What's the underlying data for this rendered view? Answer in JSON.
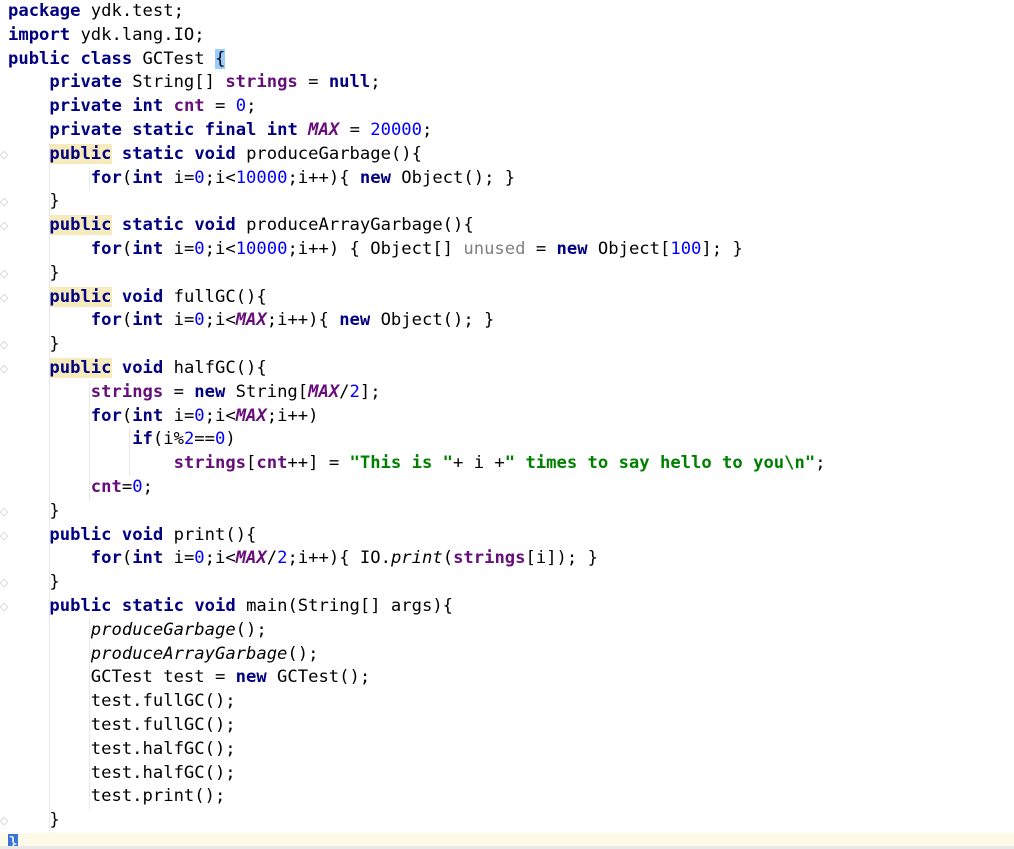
{
  "file": {
    "lines": [
      [
        {
          "t": "package",
          "c": "kw"
        },
        {
          "t": " ydk.test;"
        }
      ],
      [
        {
          "t": "import",
          "c": "kw"
        },
        {
          "t": " ydk.lang.IO;"
        }
      ],
      [
        {
          "t": "public",
          "c": "kw"
        },
        {
          "t": " "
        },
        {
          "t": "class",
          "c": "kw"
        },
        {
          "t": " GCTest "
        },
        {
          "t": "{",
          "c": "brace-hl"
        }
      ],
      [
        {
          "t": "    "
        },
        {
          "t": "private",
          "c": "kw"
        },
        {
          "t": " String[] "
        },
        {
          "t": "strings",
          "c": "fld"
        },
        {
          "t": " = "
        },
        {
          "t": "null",
          "c": "kw"
        },
        {
          "t": ";"
        }
      ],
      [
        {
          "t": "    "
        },
        {
          "t": "private",
          "c": "kw"
        },
        {
          "t": " "
        },
        {
          "t": "int",
          "c": "kw"
        },
        {
          "t": " "
        },
        {
          "t": "cnt",
          "c": "fld"
        },
        {
          "t": " = "
        },
        {
          "t": "0",
          "c": "num"
        },
        {
          "t": ";"
        }
      ],
      [
        {
          "t": "    "
        },
        {
          "t": "private",
          "c": "kw"
        },
        {
          "t": " "
        },
        {
          "t": "static",
          "c": "kw"
        },
        {
          "t": " "
        },
        {
          "t": "final",
          "c": "kw"
        },
        {
          "t": " "
        },
        {
          "t": "int",
          "c": "kw"
        },
        {
          "t": " "
        },
        {
          "t": "MAX",
          "c": "cst"
        },
        {
          "t": " = "
        },
        {
          "t": "20000",
          "c": "num"
        },
        {
          "t": ";"
        }
      ],
      [
        {
          "t": "    "
        },
        {
          "t": "public",
          "c": "kw hl-kw"
        },
        {
          "t": " "
        },
        {
          "t": "static",
          "c": "kw"
        },
        {
          "t": " "
        },
        {
          "t": "void",
          "c": "kw"
        },
        {
          "t": " produceGarbage(){"
        }
      ],
      [
        {
          "t": "        "
        },
        {
          "t": "for",
          "c": "kw"
        },
        {
          "t": "("
        },
        {
          "t": "int",
          "c": "kw"
        },
        {
          "t": " i="
        },
        {
          "t": "0",
          "c": "num"
        },
        {
          "t": ";i<"
        },
        {
          "t": "10000",
          "c": "num"
        },
        {
          "t": ";i++){ "
        },
        {
          "t": "new",
          "c": "kw"
        },
        {
          "t": " Object(); }"
        }
      ],
      [
        {
          "t": "    }"
        }
      ],
      [
        {
          "t": "    "
        },
        {
          "t": "public",
          "c": "kw hl-kw"
        },
        {
          "t": " "
        },
        {
          "t": "static",
          "c": "kw"
        },
        {
          "t": " "
        },
        {
          "t": "void",
          "c": "kw"
        },
        {
          "t": " produceArrayGarbage(){"
        }
      ],
      [
        {
          "t": "        "
        },
        {
          "t": "for",
          "c": "kw"
        },
        {
          "t": "("
        },
        {
          "t": "int",
          "c": "kw"
        },
        {
          "t": " i="
        },
        {
          "t": "0",
          "c": "num"
        },
        {
          "t": ";i<"
        },
        {
          "t": "10000",
          "c": "num"
        },
        {
          "t": ";i++) { Object[] "
        },
        {
          "t": "unused",
          "c": "unused"
        },
        {
          "t": " = "
        },
        {
          "t": "new",
          "c": "kw"
        },
        {
          "t": " Object["
        },
        {
          "t": "100",
          "c": "num"
        },
        {
          "t": "]; }"
        }
      ],
      [
        {
          "t": "    }"
        }
      ],
      [
        {
          "t": "    "
        },
        {
          "t": "public",
          "c": "kw hl-kw"
        },
        {
          "t": " "
        },
        {
          "t": "void",
          "c": "kw"
        },
        {
          "t": " fullGC(){"
        }
      ],
      [
        {
          "t": "        "
        },
        {
          "t": "for",
          "c": "kw"
        },
        {
          "t": "("
        },
        {
          "t": "int",
          "c": "kw"
        },
        {
          "t": " i="
        },
        {
          "t": "0",
          "c": "num"
        },
        {
          "t": ";i<"
        },
        {
          "t": "MAX",
          "c": "cst"
        },
        {
          "t": ";i++){ "
        },
        {
          "t": "new",
          "c": "kw"
        },
        {
          "t": " Object(); }"
        }
      ],
      [
        {
          "t": "    }"
        }
      ],
      [
        {
          "t": "    "
        },
        {
          "t": "public",
          "c": "kw hl-kw"
        },
        {
          "t": " "
        },
        {
          "t": "void",
          "c": "kw"
        },
        {
          "t": " halfGC(){"
        }
      ],
      [
        {
          "t": "        "
        },
        {
          "t": "strings",
          "c": "fld"
        },
        {
          "t": " = "
        },
        {
          "t": "new",
          "c": "kw"
        },
        {
          "t": " String["
        },
        {
          "t": "MAX",
          "c": "cst"
        },
        {
          "t": "/"
        },
        {
          "t": "2",
          "c": "num"
        },
        {
          "t": "];"
        }
      ],
      [
        {
          "t": "        "
        },
        {
          "t": "for",
          "c": "kw"
        },
        {
          "t": "("
        },
        {
          "t": "int",
          "c": "kw"
        },
        {
          "t": " i="
        },
        {
          "t": "0",
          "c": "num"
        },
        {
          "t": ";i<"
        },
        {
          "t": "MAX",
          "c": "cst"
        },
        {
          "t": ";i++)"
        }
      ],
      [
        {
          "t": "            "
        },
        {
          "t": "if",
          "c": "kw"
        },
        {
          "t": "(i%"
        },
        {
          "t": "2",
          "c": "num"
        },
        {
          "t": "=="
        },
        {
          "t": "0",
          "c": "num"
        },
        {
          "t": ")"
        }
      ],
      [
        {
          "t": "                "
        },
        {
          "t": "strings",
          "c": "fld"
        },
        {
          "t": "["
        },
        {
          "t": "cnt",
          "c": "fld"
        },
        {
          "t": "++] = "
        },
        {
          "t": "\"This is \"",
          "c": "str"
        },
        {
          "t": "+ i +"
        },
        {
          "t": "\" times to say hello to you\\n\"",
          "c": "str"
        },
        {
          "t": ";"
        }
      ],
      [
        {
          "t": "        "
        },
        {
          "t": "cnt",
          "c": "fld"
        },
        {
          "t": "="
        },
        {
          "t": "0",
          "c": "num"
        },
        {
          "t": ";"
        }
      ],
      [
        {
          "t": "    }"
        }
      ],
      [
        {
          "t": "    "
        },
        {
          "t": "public",
          "c": "kw"
        },
        {
          "t": " "
        },
        {
          "t": "void",
          "c": "kw"
        },
        {
          "t": " print(){"
        }
      ],
      [
        {
          "t": "        "
        },
        {
          "t": "for",
          "c": "kw"
        },
        {
          "t": "("
        },
        {
          "t": "int",
          "c": "kw"
        },
        {
          "t": " i="
        },
        {
          "t": "0",
          "c": "num"
        },
        {
          "t": ";i<"
        },
        {
          "t": "MAX",
          "c": "cst"
        },
        {
          "t": "/"
        },
        {
          "t": "2",
          "c": "num"
        },
        {
          "t": ";i++){ IO."
        },
        {
          "t": "print",
          "c": "mtd"
        },
        {
          "t": "("
        },
        {
          "t": "strings",
          "c": "fld"
        },
        {
          "t": "[i]); }"
        }
      ],
      [
        {
          "t": "    }"
        }
      ],
      [
        {
          "t": "    "
        },
        {
          "t": "public",
          "c": "kw"
        },
        {
          "t": " "
        },
        {
          "t": "static",
          "c": "kw"
        },
        {
          "t": " "
        },
        {
          "t": "void",
          "c": "kw"
        },
        {
          "t": " main(String[] args){"
        }
      ],
      [
        {
          "t": "        "
        },
        {
          "t": "produceGarbage",
          "c": "mtd"
        },
        {
          "t": "();"
        }
      ],
      [
        {
          "t": "        "
        },
        {
          "t": "produceArrayGarbage",
          "c": "mtd"
        },
        {
          "t": "();"
        }
      ],
      [
        {
          "t": "        GCTest test = "
        },
        {
          "t": "new",
          "c": "kw"
        },
        {
          "t": " GCTest();"
        }
      ],
      [
        {
          "t": "        test.fullGC();"
        }
      ],
      [
        {
          "t": "        test.fullGC();"
        }
      ],
      [
        {
          "t": "        test.halfGC();"
        }
      ],
      [
        {
          "t": "        test.halfGC();"
        }
      ],
      [
        {
          "t": "        test.print();"
        }
      ],
      [
        {
          "t": "    }"
        }
      ],
      [
        {
          "t": "}",
          "c": "brace-hl2"
        }
      ]
    ],
    "current_line": 35
  },
  "gutter": {
    "fold_marker_icon": "fold-marker-icon",
    "fold_lines": [
      6,
      8,
      9,
      11,
      12,
      14,
      15,
      21,
      22,
      24,
      25,
      34
    ]
  },
  "colors": {
    "keyword": "#000080",
    "field": "#660e7a",
    "number": "#0000ff",
    "string": "#008000",
    "unused": "#808080",
    "current_line": "#fdfbe8",
    "brace_match": "#99ccff"
  }
}
